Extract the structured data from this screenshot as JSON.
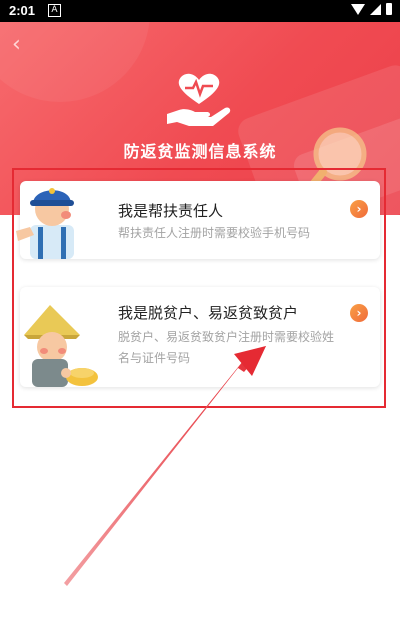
{
  "status_bar": {
    "time": "2:01",
    "notification": "A"
  },
  "header": {
    "title": "防返贫监测信息系统",
    "back_icon": "chevron-left-icon",
    "logo_icon": "heart-hand-icon",
    "colors": {
      "gradient_start": "#f76b6e",
      "gradient_end": "#ec3f49"
    }
  },
  "options": [
    {
      "title": "我是帮扶责任人",
      "subtitle": "帮扶责任人注册时需要校验手机号码",
      "icon": "worker-avatar-icon"
    },
    {
      "title": "我是脱贫户、易返贫致贫户",
      "subtitle": "脱贫户、易返贫致贫户注册时需要校验姓名与证件号码",
      "icon": "farmer-avatar-icon"
    }
  ],
  "annotation": {
    "highlight_color": "#e52a33"
  }
}
